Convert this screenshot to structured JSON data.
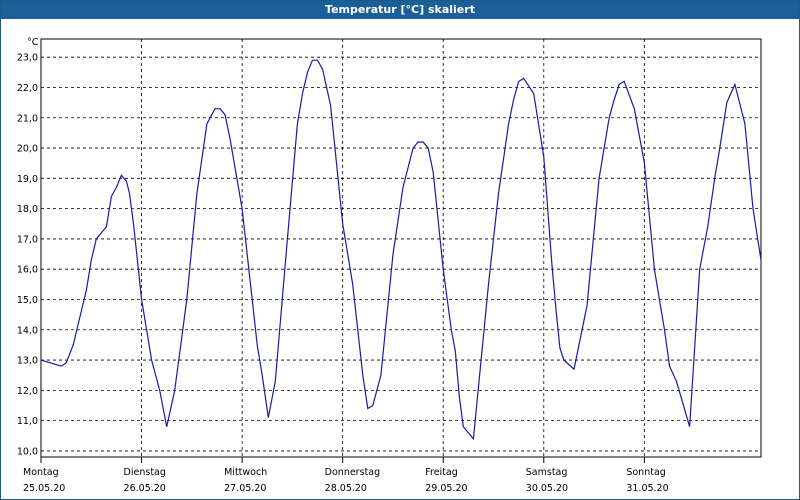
{
  "window": {
    "title": "Temperatur [°C] skaliert"
  },
  "colors": {
    "titlebar": "#1b5f98",
    "series": "#1a1aa6",
    "grid": "#000000"
  },
  "chart_data": {
    "type": "line",
    "title": "Temperatur [°C] skaliert",
    "ylabel": "°C",
    "xlabel": "",
    "ylim": [
      9.8,
      23.6
    ],
    "xlim": [
      0,
      7.16
    ],
    "grid": true,
    "legend": "none",
    "y_ticks": [
      "10,0",
      "11,0",
      "12,0",
      "13,0",
      "14,0",
      "15,0",
      "16,0",
      "17,0",
      "18,0",
      "19,0",
      "20,0",
      "21,0",
      "22,0",
      "23,0"
    ],
    "x_ticks": [
      {
        "day": "Montag",
        "date": "25.05.20"
      },
      {
        "day": "Dienstag",
        "date": "26.05.20"
      },
      {
        "day": "Mittwoch",
        "date": "27.05.20"
      },
      {
        "day": "Donnerstag",
        "date": "28.05.20"
      },
      {
        "day": "Freitag",
        "date": "29.05.20"
      },
      {
        "day": "Samstag",
        "date": "30.05.20"
      },
      {
        "day": "Sonntag",
        "date": "31.05.20"
      }
    ],
    "series": [
      {
        "x": [
          0,
          0.1,
          0.2,
          0.25,
          0.32,
          0.4,
          0.45,
          0.5,
          0.55,
          0.6,
          0.65,
          0.7,
          0.75,
          0.8,
          0.85,
          0.88,
          0.92,
          1.0,
          1.1,
          1.18,
          1.25,
          1.33,
          1.45,
          1.55,
          1.65,
          1.73,
          1.78,
          1.83,
          1.88,
          2.0,
          2.1,
          2.15,
          2.2,
          2.26,
          2.33,
          2.45,
          2.55,
          2.6,
          2.65,
          2.7,
          2.75,
          2.8,
          2.88,
          3.0,
          3.1,
          3.2,
          3.25,
          3.3,
          3.38,
          3.5,
          3.6,
          3.7,
          3.75,
          3.8,
          3.85,
          3.9,
          4.0,
          4.08,
          4.12,
          4.16,
          4.2,
          4.3,
          4.45,
          4.55,
          4.65,
          4.7,
          4.75,
          4.8,
          4.9,
          5.0,
          5.08,
          5.12,
          5.16,
          5.2,
          5.3,
          5.43,
          5.55,
          5.65,
          5.7,
          5.75,
          5.8,
          5.9,
          6.0,
          6.1,
          6.15,
          6.2,
          6.25,
          6.32,
          6.45,
          6.55,
          6.63,
          6.7,
          6.75,
          6.82,
          6.9,
          7.0,
          7.08,
          7.16
        ],
        "y": [
          13.0,
          12.9,
          12.8,
          12.9,
          13.5,
          14.6,
          15.3,
          16.3,
          17.0,
          17.2,
          17.4,
          18.4,
          18.7,
          19.1,
          18.9,
          18.5,
          17.5,
          15.0,
          13.0,
          12.0,
          10.8,
          12.0,
          15.0,
          18.5,
          20.8,
          21.3,
          21.3,
          21.1,
          20.3,
          18.0,
          15.0,
          13.5,
          12.5,
          11.1,
          12.3,
          17.0,
          20.8,
          21.8,
          22.5,
          22.9,
          22.9,
          22.6,
          21.4,
          17.5,
          15.5,
          12.5,
          11.4,
          11.5,
          12.5,
          16.5,
          18.7,
          20.0,
          20.2,
          20.2,
          20.0,
          19.2,
          16.0,
          14.0,
          13.3,
          11.8,
          10.8,
          10.4,
          15.5,
          18.5,
          20.8,
          21.6,
          22.2,
          22.3,
          21.8,
          19.7,
          16.2,
          14.7,
          13.4,
          13.0,
          12.7,
          14.8,
          19.0,
          21.0,
          21.6,
          22.1,
          22.2,
          21.3,
          19.5,
          16.0,
          15.0,
          14.0,
          12.8,
          12.3,
          10.8,
          16.0,
          17.4,
          19.0,
          20.0,
          21.5,
          22.1,
          20.8,
          18.0,
          16.3
        ]
      }
    ]
  }
}
